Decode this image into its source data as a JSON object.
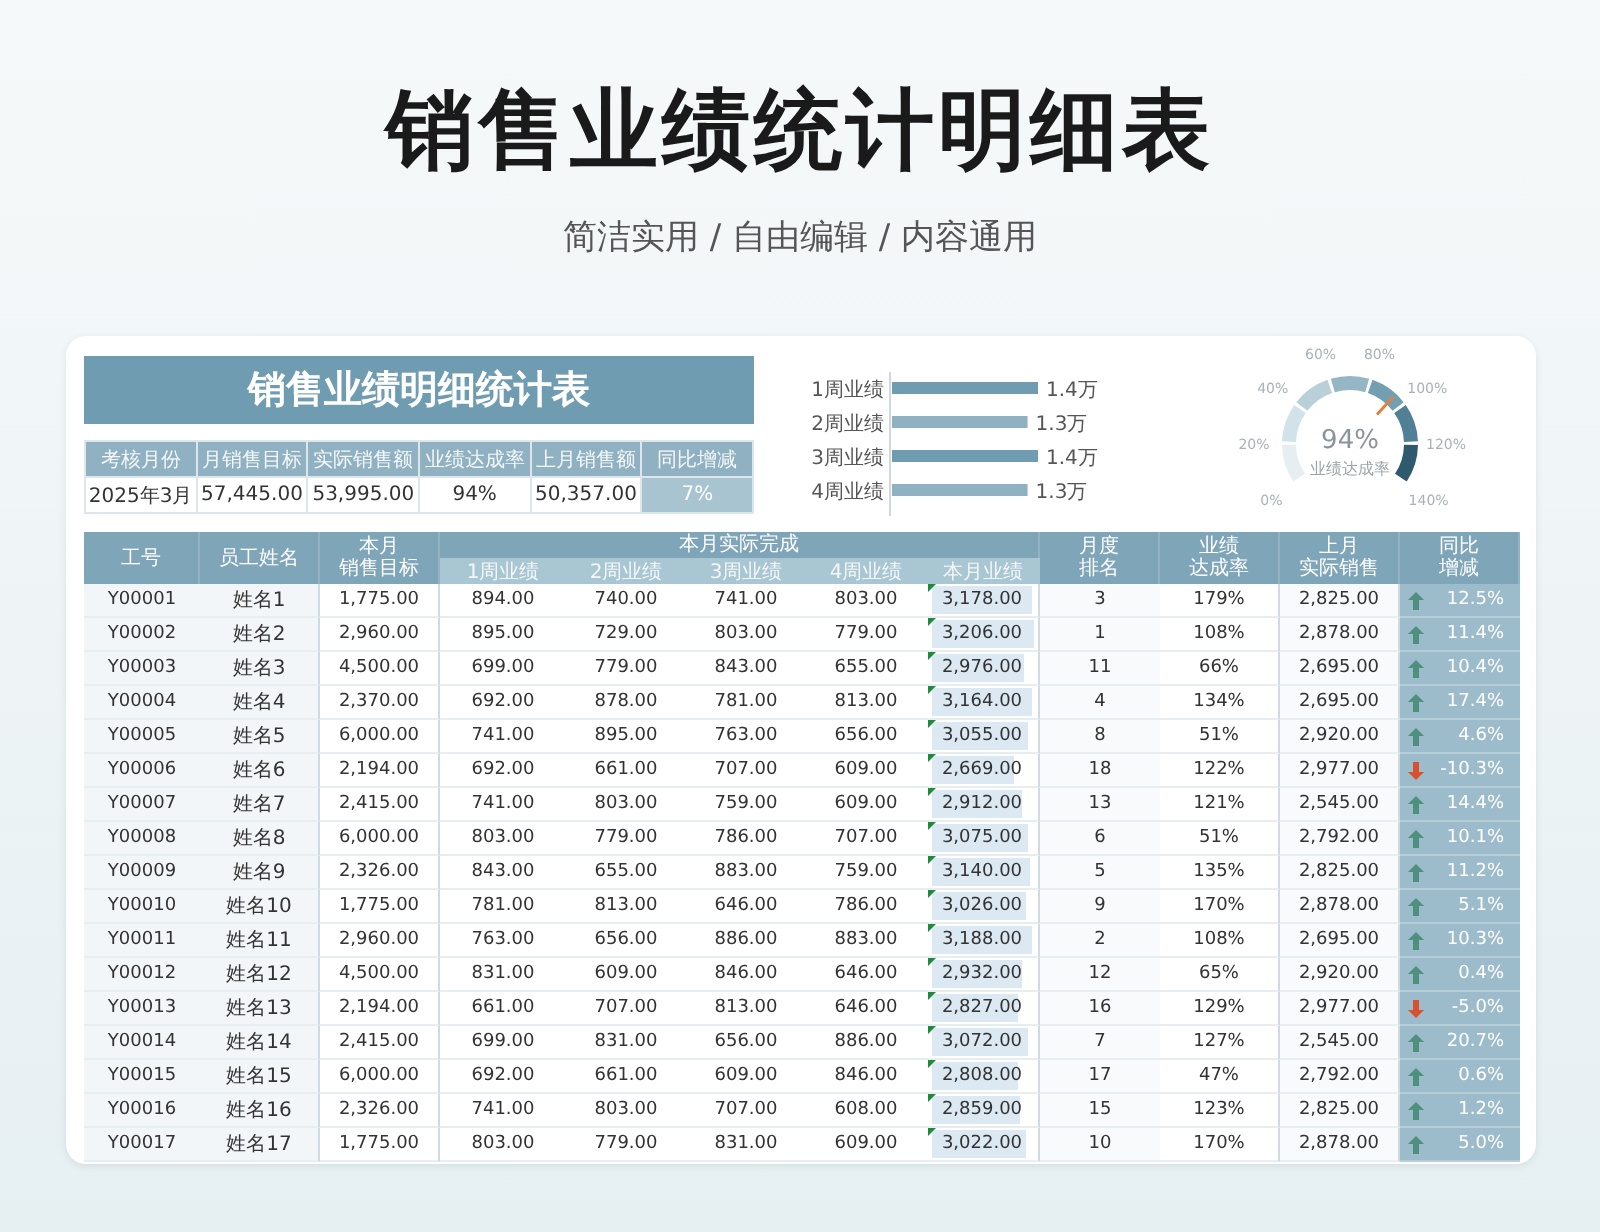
{
  "page": {
    "title": "销售业绩统计明细表",
    "subtitle": "简洁实用 / 自由编辑 / 内容通用"
  },
  "summary": {
    "title": "销售业绩明细统计表",
    "columns": [
      "考核月份",
      "月销售目标",
      "实际销售额",
      "业绩达成率",
      "上月销售额",
      "同比增减"
    ],
    "values": [
      "2025年3月",
      "57,445.00",
      "53,995.00",
      "94%",
      "50,357.00",
      "7%"
    ]
  },
  "week_chart": {
    "chart_data": {
      "type": "bar",
      "orientation": "horizontal",
      "categories": [
        "1周业绩",
        "2周业绩",
        "3周业绩",
        "4周业绩"
      ],
      "xlim": [
        0,
        1.4
      ],
      "values": [
        1.4,
        1.3,
        1.4,
        1.3
      ],
      "value_labels": [
        "1.4万",
        "1.3万",
        "1.4万",
        "1.3万"
      ]
    }
  },
  "gauge": {
    "value": "94%",
    "label": "业绩达成率",
    "level": 0.67,
    "ticks": [
      "0%",
      "20%",
      "40%",
      "60%",
      "80%",
      "100%",
      "120%",
      "140%"
    ]
  },
  "table": {
    "columns": [
      {
        "label": "工号"
      },
      {
        "label": "员工姓名"
      },
      {
        "lines": [
          "本月",
          "销售目标"
        ]
      },
      {
        "label": "本月实际完成",
        "children": [
          "1周业绩",
          "2周业绩",
          "3周业绩",
          "4周业绩",
          "本月业绩"
        ]
      },
      {
        "lines": [
          "月度",
          "排名"
        ]
      },
      {
        "lines": [
          "业绩",
          "达成率"
        ]
      },
      {
        "lines": [
          "上月",
          "实际销售"
        ]
      },
      {
        "lines": [
          "同比",
          "增减"
        ]
      }
    ],
    "rows": [
      {
        "id": "Y00001",
        "name": "姓名1",
        "target": "1,775.00",
        "weeks": [
          "894.00",
          "740.00",
          "741.00",
          "803.00"
        ],
        "month_total": "3,178.00",
        "level": 0.99,
        "rank": "3",
        "rate": "179%",
        "last_month": "2,825.00",
        "yoy": "12.5%",
        "rising": true
      },
      {
        "id": "Y00002",
        "name": "姓名2",
        "target": "2,960.00",
        "weeks": [
          "895.00",
          "729.00",
          "803.00",
          "779.00"
        ],
        "month_total": "3,206.00",
        "level": 1,
        "rank": "1",
        "rate": "108%",
        "last_month": "2,878.00",
        "yoy": "11.4%",
        "rising": true
      },
      {
        "id": "Y00003",
        "name": "姓名3",
        "target": "4,500.00",
        "weeks": [
          "699.00",
          "779.00",
          "843.00",
          "655.00"
        ],
        "month_total": "2,976.00",
        "level": 0.9,
        "rank": "11",
        "rate": "66%",
        "last_month": "2,695.00",
        "yoy": "10.4%",
        "rising": true
      },
      {
        "id": "Y00004",
        "name": "姓名4",
        "target": "2,370.00",
        "weeks": [
          "692.00",
          "878.00",
          "781.00",
          "813.00"
        ],
        "month_total": "3,164.00",
        "level": 0.98,
        "rank": "4",
        "rate": "134%",
        "last_month": "2,695.00",
        "yoy": "17.4%",
        "rising": true
      },
      {
        "id": "Y00005",
        "name": "姓名5",
        "target": "6,000.00",
        "weeks": [
          "741.00",
          "895.00",
          "763.00",
          "656.00"
        ],
        "month_total": "3,055.00",
        "level": 0.94,
        "rank": "8",
        "rate": "51%",
        "last_month": "2,920.00",
        "yoy": "4.6%",
        "rising": true
      },
      {
        "id": "Y00006",
        "name": "姓名6",
        "target": "2,194.00",
        "weeks": [
          "692.00",
          "661.00",
          "707.00",
          "609.00"
        ],
        "month_total": "2,669.00",
        "level": 0.8,
        "rank": "18",
        "rate": "122%",
        "last_month": "2,977.00",
        "yoy": "-10.3%",
        "rising": false
      },
      {
        "id": "Y00007",
        "name": "姓名7",
        "target": "2,415.00",
        "weeks": [
          "741.00",
          "803.00",
          "759.00",
          "609.00"
        ],
        "month_total": "2,912.00",
        "level": 0.88,
        "rank": "13",
        "rate": "121%",
        "last_month": "2,545.00",
        "yoy": "14.4%",
        "rising": true
      },
      {
        "id": "Y00008",
        "name": "姓名8",
        "target": "6,000.00",
        "weeks": [
          "803.00",
          "779.00",
          "786.00",
          "707.00"
        ],
        "month_total": "3,075.00",
        "level": 0.95,
        "rank": "6",
        "rate": "51%",
        "last_month": "2,792.00",
        "yoy": "10.1%",
        "rising": true
      },
      {
        "id": "Y00009",
        "name": "姓名9",
        "target": "2,326.00",
        "weeks": [
          "843.00",
          "655.00",
          "883.00",
          "759.00"
        ],
        "month_total": "3,140.00",
        "level": 0.97,
        "rank": "5",
        "rate": "135%",
        "last_month": "2,825.00",
        "yoy": "11.2%",
        "rising": true
      },
      {
        "id": "Y00010",
        "name": "姓名10",
        "target": "1,775.00",
        "weeks": [
          "781.00",
          "813.00",
          "646.00",
          "786.00"
        ],
        "month_total": "3,026.00",
        "level": 0.93,
        "rank": "9",
        "rate": "170%",
        "last_month": "2,878.00",
        "yoy": "5.1%",
        "rising": true
      },
      {
        "id": "Y00011",
        "name": "姓名11",
        "target": "2,960.00",
        "weeks": [
          "763.00",
          "656.00",
          "886.00",
          "883.00"
        ],
        "month_total": "3,188.00",
        "level": 0.99,
        "rank": "2",
        "rate": "108%",
        "last_month": "2,695.00",
        "yoy": "10.3%",
        "rising": true
      },
      {
        "id": "Y00012",
        "name": "姓名12",
        "target": "4,500.00",
        "weeks": [
          "831.00",
          "609.00",
          "846.00",
          "646.00"
        ],
        "month_total": "2,932.00",
        "level": 0.89,
        "rank": "12",
        "rate": "65%",
        "last_month": "2,920.00",
        "yoy": "0.4%",
        "rising": true
      },
      {
        "id": "Y00013",
        "name": "姓名13",
        "target": "2,194.00",
        "weeks": [
          "661.00",
          "707.00",
          "813.00",
          "646.00"
        ],
        "month_total": "2,827.00",
        "level": 0.85,
        "rank": "16",
        "rate": "129%",
        "last_month": "2,977.00",
        "yoy": "-5.0%",
        "rising": false
      },
      {
        "id": "Y00014",
        "name": "姓名14",
        "target": "2,415.00",
        "weeks": [
          "699.00",
          "831.00",
          "656.00",
          "886.00"
        ],
        "month_total": "3,072.00",
        "level": 0.95,
        "rank": "7",
        "rate": "127%",
        "last_month": "2,545.00",
        "yoy": "20.7%",
        "rising": true
      },
      {
        "id": "Y00015",
        "name": "姓名15",
        "target": "6,000.00",
        "weeks": [
          "692.00",
          "661.00",
          "609.00",
          "846.00"
        ],
        "month_total": "2,808.00",
        "level": 0.84,
        "rank": "17",
        "rate": "47%",
        "last_month": "2,792.00",
        "yoy": "0.6%",
        "rising": true
      },
      {
        "id": "Y00016",
        "name": "姓名16",
        "target": "2,326.00",
        "weeks": [
          "741.00",
          "803.00",
          "707.00",
          "608.00"
        ],
        "month_total": "2,859.00",
        "level": 0.86,
        "rank": "15",
        "rate": "123%",
        "last_month": "2,825.00",
        "yoy": "1.2%",
        "rising": true
      },
      {
        "id": "Y00017",
        "name": "姓名17",
        "target": "1,775.00",
        "weeks": [
          "803.00",
          "779.00",
          "831.00",
          "609.00"
        ],
        "month_total": "3,022.00",
        "level": 0.93,
        "rank": "10",
        "rate": "170%",
        "last_month": "2,878.00",
        "yoy": "5.0%",
        "rising": true
      }
    ]
  }
}
